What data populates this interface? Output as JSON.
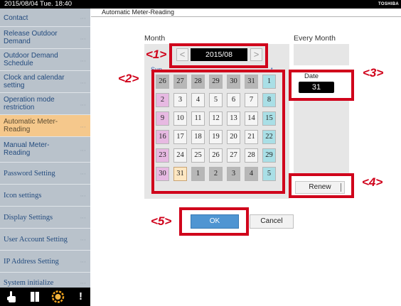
{
  "statusbar": {
    "datetime": "2015/08/04  Tue.  18:40",
    "brand": "TOSHIBA"
  },
  "sidebar": {
    "dots": "∙∙∙",
    "items": [
      {
        "label_lines": [
          "Contact"
        ]
      },
      {
        "label_lines": [
          "Release Outdoor",
          "Demand"
        ]
      },
      {
        "label_lines": [
          "Outdoor Demand",
          "Schedule"
        ]
      },
      {
        "label_lines": [
          "Clock and calendar",
          "setting"
        ]
      },
      {
        "label_lines": [
          "Operation mode",
          "restriction"
        ]
      },
      {
        "label_lines": [
          "Automatic Meter-",
          "Reading"
        ],
        "active": true
      },
      {
        "label_lines": [
          "Manual Meter-",
          "Reading"
        ]
      },
      {
        "label_lines": [
          "Password Setting"
        ]
      },
      {
        "label_lines": [
          "Icon settings"
        ]
      },
      {
        "label_lines": [
          "Display Settings"
        ]
      },
      {
        "label_lines": [
          "User Account Setting"
        ]
      },
      {
        "label_lines": [
          "IP Address Setting"
        ]
      },
      {
        "label_lines": [
          "System initialize"
        ]
      }
    ]
  },
  "toolbar": {
    "icons": [
      "hand-pointer-icon",
      "book-icon",
      "sun-icon",
      "alert-icon"
    ],
    "alert_glyph": "!"
  },
  "main": {
    "title": "Automatic Meter-Reading",
    "month_label": "Month",
    "every_month_label": "Every Month",
    "nav_prev": "<",
    "nav_next": ">",
    "month_value": "2015/08",
    "weekday_fragment_left": "Sun",
    "weekday_fragment_right": "t",
    "calendar": {
      "weeks": [
        [
          {
            "d": "26",
            "t": "other"
          },
          {
            "d": "27",
            "t": "other"
          },
          {
            "d": "28",
            "t": "other"
          },
          {
            "d": "29",
            "t": "other"
          },
          {
            "d": "30",
            "t": "other"
          },
          {
            "d": "31",
            "t": "other"
          },
          {
            "d": "1",
            "t": "sat"
          }
        ],
        [
          {
            "d": "2",
            "t": "sun"
          },
          {
            "d": "3",
            "t": "day"
          },
          {
            "d": "4",
            "t": "day"
          },
          {
            "d": "5",
            "t": "day"
          },
          {
            "d": "6",
            "t": "day"
          },
          {
            "d": "7",
            "t": "day"
          },
          {
            "d": "8",
            "t": "sat"
          }
        ],
        [
          {
            "d": "9",
            "t": "sun"
          },
          {
            "d": "10",
            "t": "day"
          },
          {
            "d": "11",
            "t": "day"
          },
          {
            "d": "12",
            "t": "day"
          },
          {
            "d": "13",
            "t": "day"
          },
          {
            "d": "14",
            "t": "day"
          },
          {
            "d": "15",
            "t": "sat"
          }
        ],
        [
          {
            "d": "16",
            "t": "sun"
          },
          {
            "d": "17",
            "t": "day"
          },
          {
            "d": "18",
            "t": "day"
          },
          {
            "d": "19",
            "t": "day"
          },
          {
            "d": "20",
            "t": "day"
          },
          {
            "d": "21",
            "t": "day"
          },
          {
            "d": "22",
            "t": "sat"
          }
        ],
        [
          {
            "d": "23",
            "t": "sun"
          },
          {
            "d": "24",
            "t": "day"
          },
          {
            "d": "25",
            "t": "day"
          },
          {
            "d": "26",
            "t": "day"
          },
          {
            "d": "27",
            "t": "day"
          },
          {
            "d": "28",
            "t": "day"
          },
          {
            "d": "29",
            "t": "sat"
          }
        ],
        [
          {
            "d": "30",
            "t": "sun"
          },
          {
            "d": "31",
            "t": "today"
          },
          {
            "d": "1",
            "t": "other"
          },
          {
            "d": "2",
            "t": "other"
          },
          {
            "d": "3",
            "t": "other"
          },
          {
            "d": "4",
            "t": "other"
          },
          {
            "d": "5",
            "t": "sat"
          }
        ]
      ]
    },
    "date_label": "Date",
    "date_value": "31",
    "renew_label": "Renew",
    "ok_label": "OK",
    "cancel_label": "Cancel"
  },
  "annotations": [
    "<1>",
    "<2>",
    "<3>",
    "<4>",
    "<5>"
  ],
  "colors": {
    "highlight": "#d0021b",
    "active_item": "#f5c88c",
    "ok_button": "#4f95d2",
    "sunday": "#e7b9e2",
    "saturday": "#a9dfe6"
  }
}
